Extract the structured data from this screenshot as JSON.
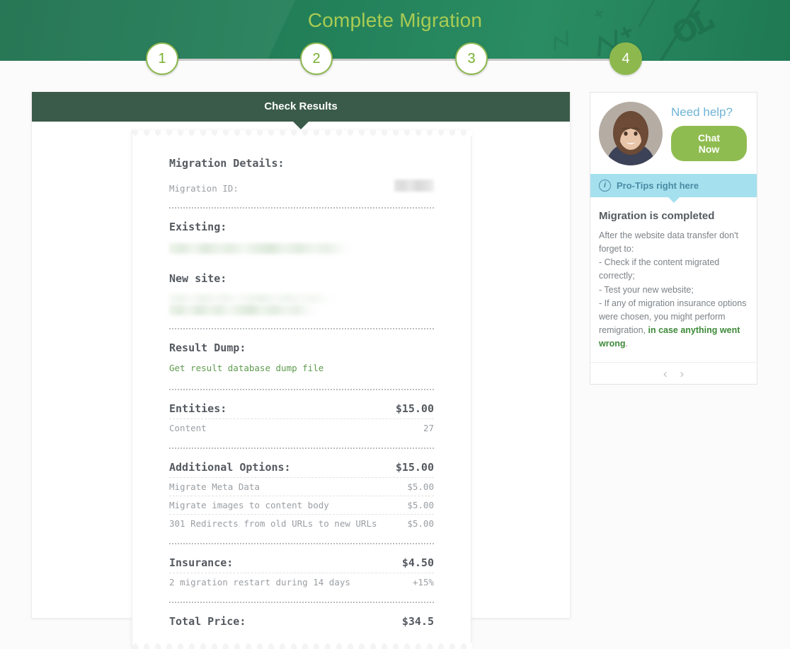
{
  "header": {
    "title": "Complete Migration"
  },
  "stepper": {
    "steps": [
      {
        "label": "1",
        "state": "pending"
      },
      {
        "label": "2",
        "state": "pending"
      },
      {
        "label": "3",
        "state": "pending"
      },
      {
        "label": "4",
        "state": "current"
      }
    ]
  },
  "main": {
    "panel_title": "Check Results",
    "receipt": {
      "details_title": "Migration Details:",
      "migration_id_label": "Migration ID:",
      "migration_id_value": "",
      "existing_title": "Existing:",
      "existing_value": "",
      "new_site_title": "New site:",
      "new_site_value": "",
      "result_dump_title": "Result Dump:",
      "result_dump_link": "Get result database dump file",
      "entities": {
        "title": "Entities:",
        "total": "$15.00",
        "rows": [
          {
            "label": "Content",
            "value": "27"
          }
        ]
      },
      "additional_options": {
        "title": "Additional Options:",
        "total": "$15.00",
        "rows": [
          {
            "label": "Migrate Meta Data",
            "value": "$5.00"
          },
          {
            "label": "Migrate images to content body",
            "value": "$5.00"
          },
          {
            "label": "301 Redirects from old URLs to new URLs",
            "value": "$5.00"
          }
        ]
      },
      "insurance": {
        "title": "Insurance:",
        "total": "$4.50",
        "rows": [
          {
            "label": "2 migration restart during 14 days",
            "value": "+15%"
          }
        ]
      },
      "total": {
        "title": "Total Price:",
        "value": "$34.5"
      }
    }
  },
  "sidebar": {
    "need_help_label": "Need help?",
    "chat_button_label": "Chat Now",
    "protips_bar_label": "Pro-Tips right here",
    "tip_title": "Migration is completed",
    "tip_text_part1": "After the website data transfer don't forget to:",
    "tip_text_part2": "- Check if the content migrated correctly;",
    "tip_text_part3": "- Test your new website;",
    "tip_text_part4": "- If any of migration insurance options were chosen, you might perform remigration, ",
    "tip_text_bold": "in case anything went wrong",
    "tip_text_end": ".",
    "prev_arrow": "‹",
    "next_arrow": "›"
  },
  "colors": {
    "header_green": "#1e7a52",
    "title_green": "#a9cb53",
    "step_green": "#8db84e",
    "panel_dark_green": "#3a5b49",
    "chat_green": "#8fbc50",
    "protips_cyan": "#a5e0ef",
    "need_help_blue": "#6fb4d6",
    "link_green": "#5e9b4e"
  }
}
